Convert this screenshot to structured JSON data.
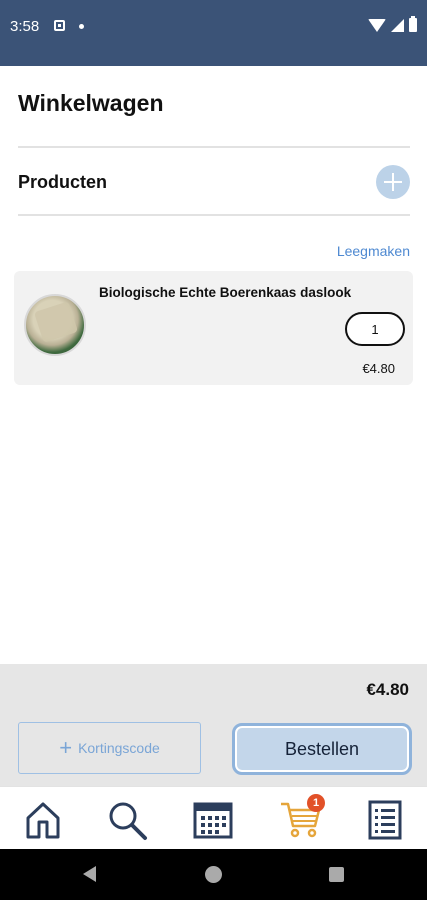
{
  "status_bar": {
    "time": "3:58"
  },
  "header": {
    "title": "Winkelwagen"
  },
  "products_section": {
    "title": "Producten",
    "clear_label": "Leegmaken"
  },
  "cart_items": [
    {
      "name": "Biologische Echte Boerenkaas daslook",
      "quantity": "1",
      "price": "€4.80"
    }
  ],
  "summary": {
    "total": "€4.80"
  },
  "actions": {
    "discount_label": "Kortingscode",
    "order_label": "Bestellen"
  },
  "tabbar": {
    "items": [
      {
        "icon": "home-icon"
      },
      {
        "icon": "search-icon"
      },
      {
        "icon": "calendar-icon"
      },
      {
        "icon": "cart-icon",
        "badge": "1",
        "active": true
      },
      {
        "icon": "list-icon"
      }
    ]
  },
  "colors": {
    "primary": "#3b5377",
    "accent": "#4e89d1",
    "active_tab": "#e5a53b",
    "badge": "#e25128"
  }
}
